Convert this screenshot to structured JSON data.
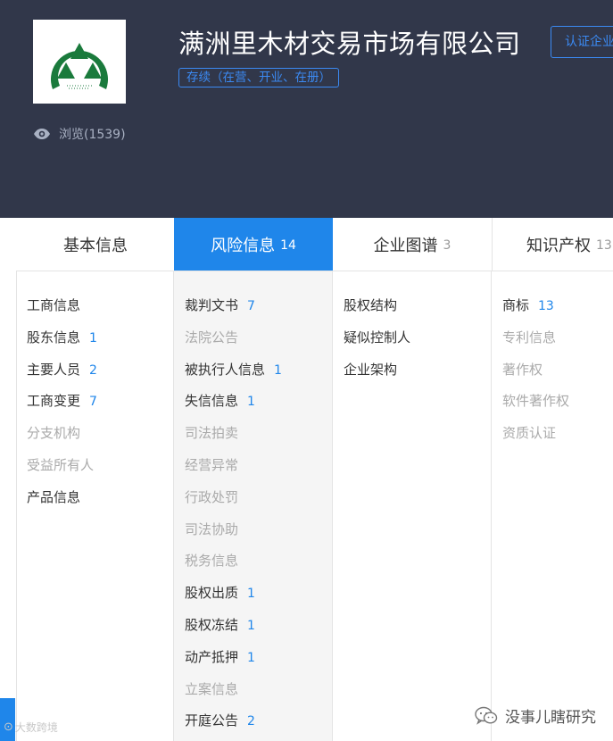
{
  "header": {
    "company_name": "满洲里木材交易市场有限公司",
    "status_badge": "存续（在营、开业、在册）",
    "certify_button": "认证企业",
    "views_label": "浏览(1539)"
  },
  "tabs": [
    {
      "label": "基本信息",
      "count": ""
    },
    {
      "label": "风险信息",
      "count": "14"
    },
    {
      "label": "企业图谱",
      "count": "3"
    },
    {
      "label": "知识产权",
      "count": "13"
    }
  ],
  "basic_items": [
    {
      "label": "工商信息",
      "count": ""
    },
    {
      "label": "股东信息",
      "count": "1"
    },
    {
      "label": "主要人员",
      "count": "2"
    },
    {
      "label": "工商变更",
      "count": "7"
    },
    {
      "label": "分支机构",
      "count": ""
    },
    {
      "label": "受益所有人",
      "count": ""
    },
    {
      "label": "产品信息",
      "count": ""
    }
  ],
  "risk_items": [
    {
      "label": "裁判文书",
      "count": "7"
    },
    {
      "label": "法院公告",
      "count": ""
    },
    {
      "label": "被执行人信息",
      "count": "1"
    },
    {
      "label": "失信信息",
      "count": "1"
    },
    {
      "label": "司法拍卖",
      "count": ""
    },
    {
      "label": "经营异常",
      "count": ""
    },
    {
      "label": "行政处罚",
      "count": ""
    },
    {
      "label": "司法协助",
      "count": ""
    },
    {
      "label": "税务信息",
      "count": ""
    },
    {
      "label": "股权出质",
      "count": "1"
    },
    {
      "label": "股权冻结",
      "count": "1"
    },
    {
      "label": "动产抵押",
      "count": "1"
    },
    {
      "label": "立案信息",
      "count": ""
    },
    {
      "label": "开庭公告",
      "count": "2"
    }
  ],
  "graph_items": [
    {
      "label": "股权结构",
      "count": ""
    },
    {
      "label": "疑似控制人",
      "count": ""
    },
    {
      "label": "企业架构",
      "count": ""
    }
  ],
  "ip_items": [
    {
      "label": "商标",
      "count": "13"
    },
    {
      "label": "专利信息",
      "count": ""
    },
    {
      "label": "著作权",
      "count": ""
    },
    {
      "label": "软件著作权",
      "count": ""
    },
    {
      "label": "资质认证",
      "count": ""
    }
  ],
  "watermarks": {
    "left": "大数跨境",
    "right": "没事儿瞎研究"
  },
  "colors": {
    "header_bg": "#31374a",
    "accent": "#1f86ea",
    "logo_green": "#1a7a3c",
    "inactive_text": "#aaaaaa"
  }
}
